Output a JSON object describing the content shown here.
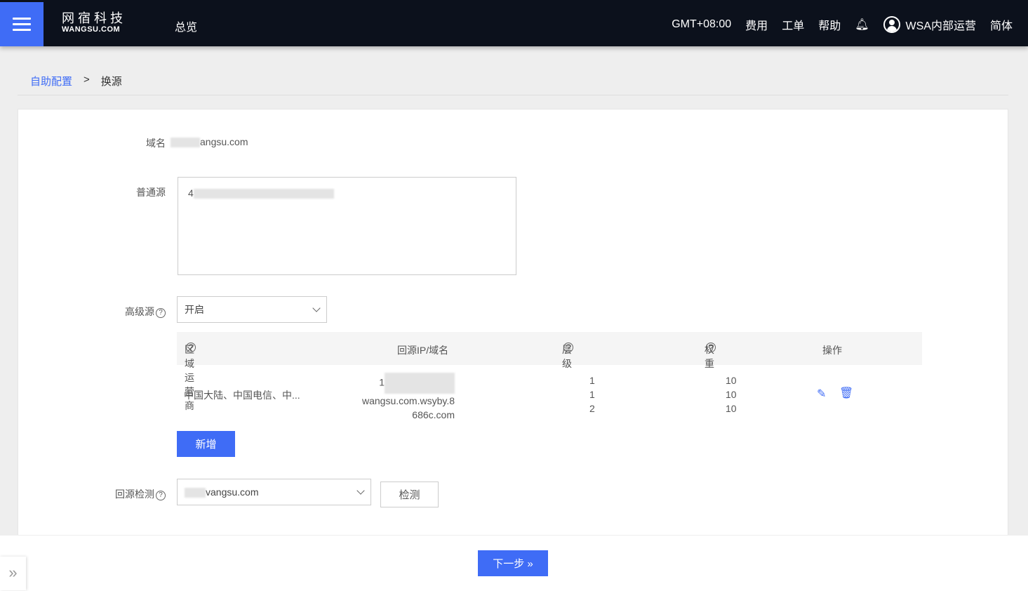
{
  "header": {
    "logo_cn": "网宿科技",
    "logo_en": "WANGSU.COM",
    "nav_overview": "总览",
    "timezone": "GMT+08:00",
    "billing": "费用",
    "ticket": "工单",
    "help": "帮助",
    "user": "WSA内部运营",
    "language": "简体"
  },
  "breadcrumb": {
    "parent": "自助配置",
    "separator": ">",
    "current": "换源"
  },
  "form": {
    "domain_label": "域名",
    "domain_value": "angsu.com",
    "normal_origin_label": "普通源",
    "normal_origin_value": "4",
    "advanced_origin_label": "高级源",
    "advanced_origin_value": "开启",
    "table": {
      "headers": [
        "区域运营商",
        "回源IP/域名",
        "层级",
        "权重",
        "操作"
      ],
      "rows": [
        {
          "region": "中国大陆、中国电信、中...",
          "origin_line1": "1",
          "origin_line2": "wangsu.com.wsyby.8",
          "origin_line3": "686c.com",
          "levels": [
            "1",
            "1",
            "2"
          ],
          "weights": [
            "10",
            "10",
            "10"
          ]
        }
      ]
    },
    "add_button": "新增",
    "check_label": "回源检测",
    "check_value": "vangsu.com",
    "check_button": "检测"
  },
  "footer": {
    "next_button": "下一步 »",
    "expand_icon": "double-chevron-right-icon"
  },
  "colors": {
    "accent": "#3f6cf6",
    "header_bg": "#0c111c"
  }
}
